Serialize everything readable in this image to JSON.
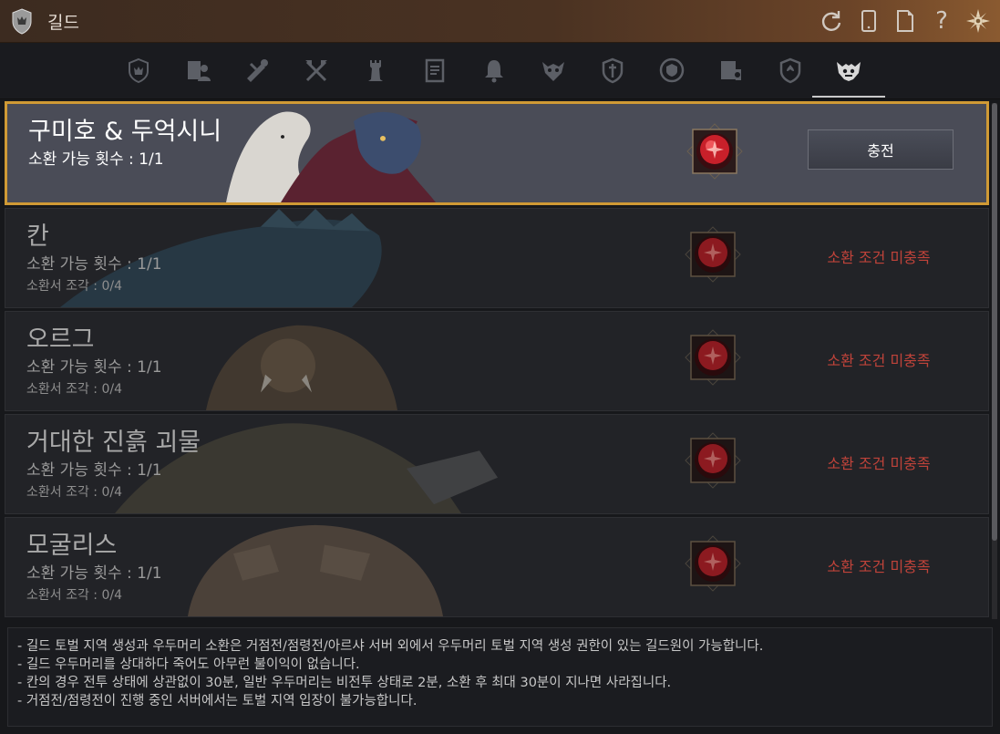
{
  "window": {
    "title": "길드"
  },
  "titlebar_icons": [
    "refresh-icon",
    "phone-icon",
    "document-icon",
    "help-icon",
    "settings-icon"
  ],
  "tabs": [
    {
      "icon": "guild-crest-icon"
    },
    {
      "icon": "guild-members-icon"
    },
    {
      "icon": "scroll-quest-icon"
    },
    {
      "icon": "crossed-axes-icon"
    },
    {
      "icon": "tower-icon"
    },
    {
      "icon": "notice-board-icon"
    },
    {
      "icon": "bell-icon"
    },
    {
      "icon": "demon-mask-icon"
    },
    {
      "icon": "shield-sword-icon"
    },
    {
      "icon": "badge-icon"
    },
    {
      "icon": "contract-icon"
    },
    {
      "icon": "fleur-shield-icon"
    },
    {
      "icon": "boss-summon-icon",
      "active": true
    }
  ],
  "bosses": [
    {
      "name": "구미호 & 두억시니",
      "count": "소환 가능 횟수 : 1/1",
      "pieces": "",
      "action": "충전",
      "status": "",
      "selected": true
    },
    {
      "name": "칸",
      "count": "소환 가능 횟수 : 1/1",
      "pieces": "소환서 조각 : 0/4",
      "action": "",
      "status": "소환 조건 미충족",
      "selected": false
    },
    {
      "name": "오르그",
      "count": "소환 가능 횟수 : 1/1",
      "pieces": "소환서 조각 : 0/4",
      "action": "",
      "status": "소환 조건 미충족",
      "selected": false
    },
    {
      "name": "거대한 진흙 괴물",
      "count": "소환 가능 횟수 : 1/1",
      "pieces": "소환서 조각 : 0/4",
      "action": "",
      "status": "소환 조건 미충족",
      "selected": false
    },
    {
      "name": "모굴리스",
      "count": "소환 가능 횟수 : 1/1",
      "pieces": "소환서 조각 : 0/4",
      "action": "",
      "status": "소환 조건 미충족",
      "selected": false
    }
  ],
  "notice": {
    "lines": [
      "- 길드 토벌 지역 생성과 우두머리 소환은 거점전/점령전/아르샤 서버 외에서 우두머리 토벌 지역 생성 권한이 있는 길드원이 가능합니다.",
      "- 길드 우두머리를 상대하다 죽어도 아무런 불이익이 없습니다.",
      "- 칸의 경우 전투 상태에 상관없이 30분, 일반 우두머리는 비전투 상태로 2분, 소환 후 최대 30분이 지나면 사라집니다.",
      "- 거점전/점령전이 진행 중인 서버에서는 토벌 지역 입장이 불가능합니다."
    ]
  },
  "colors": {
    "accent": "#d09a35",
    "status_red": "#c0433a",
    "gem_red": "#c8202a"
  }
}
